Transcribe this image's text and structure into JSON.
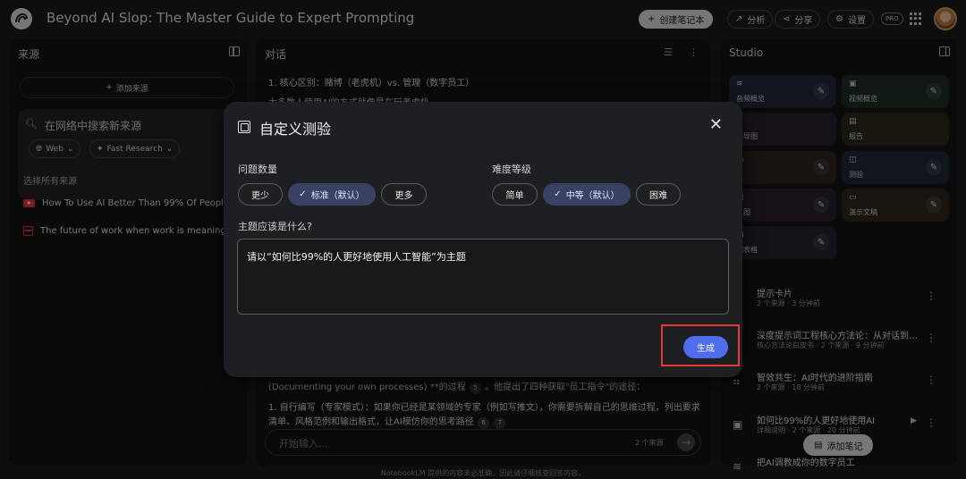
{
  "app": {
    "title": "Beyond AI Slop: The Master Guide to Expert Prompting",
    "create_notebook": "创建笔记本",
    "analytics": "分析",
    "share": "分享",
    "settings": "设置",
    "pro_badge": "PRO"
  },
  "sources_panel": {
    "title": "来源",
    "add_source": "添加来源",
    "search_placeholder": "在网络中搜索新来源",
    "chip_web": "Web",
    "chip_fast": "Fast Research",
    "select_all": "选择所有来源",
    "items": [
      {
        "label": "How To Use AI Better Than 99% Of People (...",
        "icon": "youtube-icon"
      },
      {
        "label": "The future of work when work is meaningles...",
        "icon": "document-icon"
      }
    ]
  },
  "chat_panel": {
    "title": "对话",
    "line1": "1. 核心区别：赌博（老虎机）vs. 管理（数字员工）",
    "line2": "大多数人使用AI的方式就像是在玩老虎机",
    "line3_a": "(Documenting your own processes) **的过程",
    "line3_cite": "5",
    "line3_b": "。他提出了四种获取\"员工指令\"的途径：",
    "line4": "1. 自行编写（专家模式）：如果你已经是某领域的专家（例如写推文），你需要拆解自己的思维过程，列出要求",
    "line5_a": "清单、风格范例和输出格式，让AI模仿你的思考路径",
    "line5_cite1": "6",
    "line5_cite2": "7",
    "input_placeholder": "开始输入...",
    "source_count": "2 个来源"
  },
  "studio_panel": {
    "title": "Studio",
    "tiles": [
      {
        "label": "音频概览",
        "icon": "audio-icon"
      },
      {
        "label": "视频概览",
        "icon": "video-icon"
      },
      {
        "label": "维导图",
        "icon": "mindmap-icon"
      },
      {
        "label": "报告",
        "icon": "report-icon"
      },
      {
        "label": "卡",
        "icon": "flashcard-icon"
      },
      {
        "label": "测验",
        "icon": "quiz-icon"
      },
      {
        "label": "息图",
        "icon": "infographic-icon"
      },
      {
        "label": "演示文稿",
        "icon": "slides-icon"
      },
      {
        "label": "据表格",
        "icon": "table-icon"
      }
    ],
    "notes": [
      {
        "title": "提示卡片",
        "meta": "2 个来源 · 3 分钟前",
        "icon": "flashcard-icon"
      },
      {
        "title": "深度提示词工程核心方法论：从对话到协...",
        "meta": "核心方法论白皮书 · 2 个来源 · 9 分钟前",
        "icon": "report-icon"
      },
      {
        "title": "智效共生：AI时代的进阶指南",
        "meta": "2 个来源 · 18 分钟前",
        "icon": "mindmap-icon"
      },
      {
        "title": "如何比99%的人更好地使用AI",
        "meta": "详细说明 · 2 个来源 · 20 分钟前",
        "icon": "video-icon"
      },
      {
        "title": "把AI调教成你的数字员工",
        "meta": "",
        "icon": "audio-icon"
      }
    ],
    "add_note": "添加笔记"
  },
  "footer": "NotebookLM 提供的内容未必准确，因此请仔细核查回答内容。",
  "dialog": {
    "title": "自定义测验",
    "question_count_label": "问题数量",
    "question_count_options": [
      "更少",
      "标准（默认）",
      "更多"
    ],
    "question_count_selected": "标准（默认）",
    "difficulty_label": "难度等级",
    "difficulty_options": [
      "简单",
      "中等（默认）",
      "困难"
    ],
    "difficulty_selected": "中等（默认）",
    "topic_label": "主题应该是什么?",
    "topic_value": "请以“如何比99%的人更好地使用人工智能”为主题",
    "generate": "生成"
  },
  "colors": {
    "accent": "#4f6dea",
    "selected_chip": "#3a4263",
    "highlight": "#e53935"
  }
}
